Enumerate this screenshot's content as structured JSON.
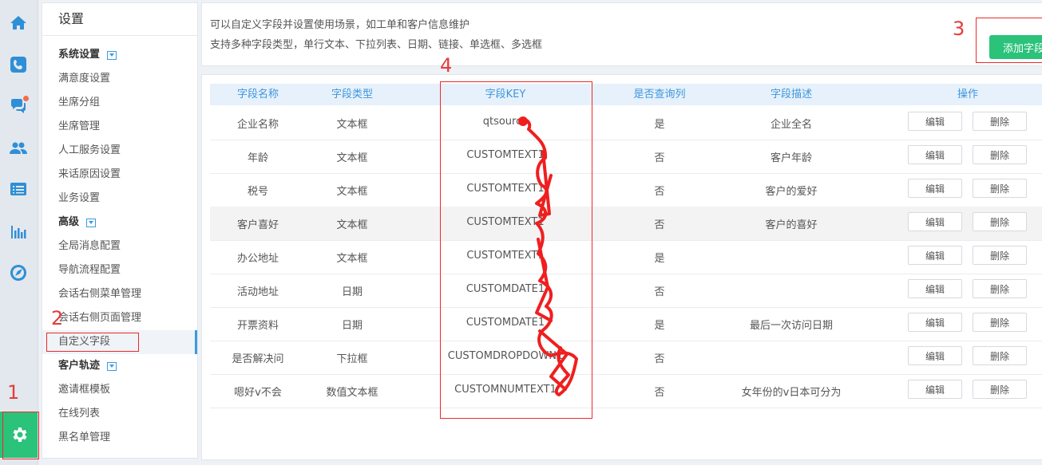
{
  "menu": {
    "title": "设置",
    "groups": [
      {
        "label": "系统设置",
        "items": [
          "满意度设置",
          "坐席分组",
          "坐席管理",
          "人工服务设置",
          "来话原因设置",
          "业务设置"
        ]
      },
      {
        "label": "高级",
        "items": [
          "全局消息配置",
          "导航流程配置",
          "会话右侧菜单管理",
          "会话右侧页面管理",
          "自定义字段"
        ]
      },
      {
        "label": "客户轨迹",
        "items": [
          "邀请框模板",
          "在线列表",
          "黑名单管理"
        ]
      }
    ],
    "active_item": "自定义字段"
  },
  "info": {
    "line1": "可以自定义字段并设置使用场景，如工单和客户信息维护",
    "line2": "支持多种字段类型，单行文本、下拉列表、日期、链接、单选框、多选框",
    "add_button": "添加字段"
  },
  "table": {
    "headers": [
      "字段名称",
      "字段类型",
      "字段KEY",
      "是否查询列",
      "字段描述",
      "操作"
    ],
    "rows": [
      {
        "name": "企业名称",
        "type": "文本框",
        "key": "qtsource",
        "query": "是",
        "desc": "企业全名"
      },
      {
        "name": "年龄",
        "type": "文本框",
        "key": "CUSTOMTEXT1",
        "query": "否",
        "desc": "客户年龄"
      },
      {
        "name": "税号",
        "type": "文本框",
        "key": "CUSTOMTEXT1",
        "query": "否",
        "desc": "客户的爱好"
      },
      {
        "name": "客户喜好",
        "type": "文本框",
        "key": "CUSTOMTEXT1",
        "query": "否",
        "desc": "客户的喜好"
      },
      {
        "name": "办公地址",
        "type": "文本框",
        "key": "CUSTOMTEXT1",
        "query": "是",
        "desc": ""
      },
      {
        "name": "活动地址",
        "type": "日期",
        "key": "CUSTOMDATE1",
        "query": "否",
        "desc": ""
      },
      {
        "name": "开票资料",
        "type": "日期",
        "key": "CUSTOMDATE1",
        "query": "是",
        "desc": "最后一次访问日期"
      },
      {
        "name": "是否解决问",
        "type": "下拉框",
        "key": "CUSTOMDROPDOWN1",
        "query": "否",
        "desc": ""
      },
      {
        "name": "嗯好v不会",
        "type": "数值文本框",
        "key": "CUSTOMNUMTEXT1",
        "query": "否",
        "desc": "女年份的v日本可分为"
      }
    ],
    "edit_label": "编辑",
    "delete_label": "删除",
    "highlighted_row": 3
  },
  "annotations": {
    "n1": "1",
    "n2": "2",
    "n3": "3",
    "n4": "4",
    "color": "#e63b3b"
  },
  "rail_icons": [
    "home-icon",
    "phone-icon",
    "chat-icon",
    "users-icon",
    "list-icon",
    "bar-chart-icon",
    "compass-icon",
    "gear-icon"
  ]
}
